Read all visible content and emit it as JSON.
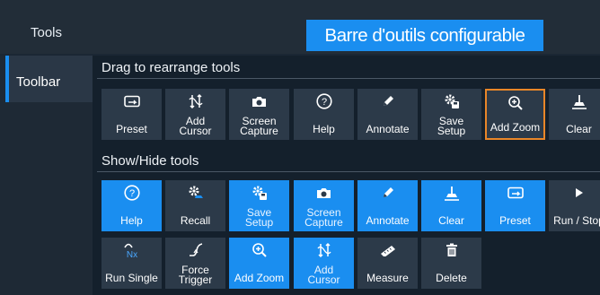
{
  "header": {
    "title": "Tools",
    "callout": "Barre d'outils configurable"
  },
  "sidebar": {
    "tab_label": "Toolbar"
  },
  "drag_section": {
    "heading": "Drag to rearrange tools",
    "tiles": [
      {
        "label": "Preset",
        "icon": "preset-icon"
      },
      {
        "label": [
          "Add",
          "Cursor"
        ],
        "icon": "cursor-icon"
      },
      {
        "label": [
          "Screen",
          "Capture"
        ],
        "icon": "camera-icon"
      },
      {
        "label": "Help",
        "icon": "help-icon"
      },
      {
        "label": "Annotate",
        "icon": "pencil-icon"
      },
      {
        "label": [
          "Save",
          "Setup"
        ],
        "icon": "save-setup-icon"
      },
      {
        "label": "Add Zoom",
        "icon": "zoom-icon",
        "selected": true
      },
      {
        "label": "Clear",
        "icon": "clear-icon"
      }
    ]
  },
  "show_section": {
    "heading": "Show/Hide tools",
    "row1": [
      {
        "label": "Help",
        "icon": "help-icon",
        "visible": true
      },
      {
        "label": "Recall",
        "icon": "recall-icon",
        "visible": false
      },
      {
        "label": [
          "Save",
          "Setup"
        ],
        "icon": "save-setup-icon",
        "visible": true
      },
      {
        "label": [
          "Screen",
          "Capture"
        ],
        "icon": "camera-icon",
        "visible": true
      },
      {
        "label": "Annotate",
        "icon": "pencil-icon",
        "visible": true
      },
      {
        "label": "Clear",
        "icon": "clear-icon",
        "visible": true
      },
      {
        "label": "Preset",
        "icon": "preset-icon",
        "visible": true
      },
      {
        "label": "Run / Stop",
        "icon": "play-icon",
        "visible": false
      }
    ],
    "row2": [
      {
        "label": "Run Single",
        "icon": "run-single-icon",
        "visible": false
      },
      {
        "label": [
          "Force",
          "Trigger"
        ],
        "icon": "trigger-icon",
        "visible": false
      },
      {
        "label": "Add Zoom",
        "icon": "zoom-icon",
        "visible": true
      },
      {
        "label": [
          "Add",
          "Cursor"
        ],
        "icon": "cursor-icon",
        "visible": true
      },
      {
        "label": "Measure",
        "icon": "ruler-icon",
        "visible": false
      },
      {
        "label": "Delete",
        "icon": "trash-icon",
        "visible": false
      }
    ]
  },
  "colors": {
    "accent": "#1a8ef0",
    "tile": "#2c3a49",
    "selection": "#e98628",
    "background": "#14202c"
  }
}
